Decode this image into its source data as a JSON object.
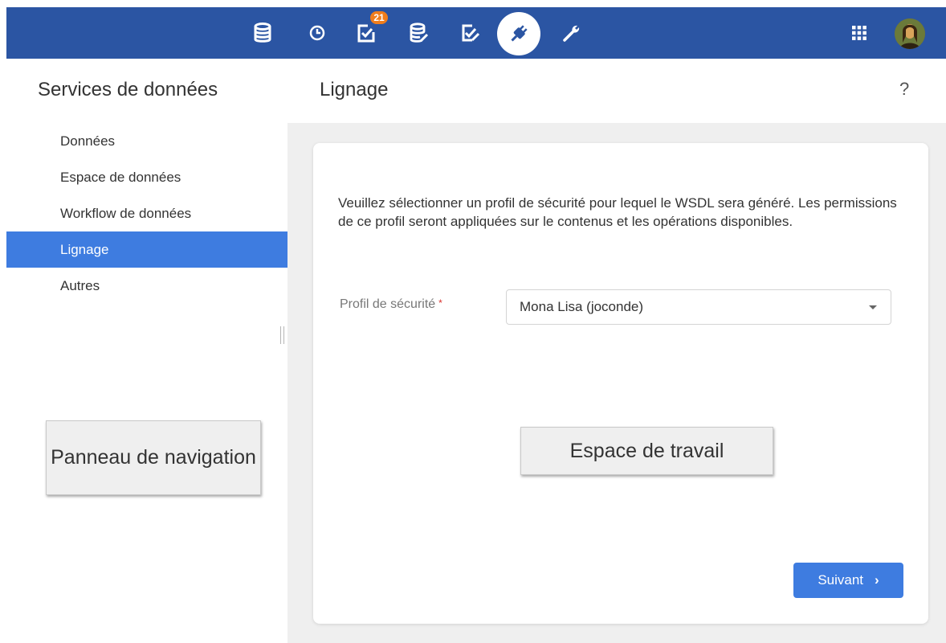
{
  "topbar": {
    "icons": [
      "database-icon",
      "clock-icon",
      "tasks-icon",
      "database-edit-icon",
      "checklist-icon",
      "plug-icon",
      "wrench-icon",
      "apps-grid-icon"
    ],
    "active_icon": "plug-icon",
    "tasks_badge": "21",
    "colors": {
      "bar": "#2b55a3",
      "badge": "#f07d1c"
    }
  },
  "header": {
    "section_title": "Services de données",
    "page_title": "Lignage",
    "help": "?"
  },
  "nav": {
    "items": [
      {
        "label": "Données"
      },
      {
        "label": "Espace de données"
      },
      {
        "label": "Workflow de données"
      },
      {
        "label": "Lignage",
        "active": true
      },
      {
        "label": "Autres"
      }
    ],
    "active_color": "#3e7ce0"
  },
  "main": {
    "description": "Veuillez sélectionner un profil de sécurité pour lequel le WSDL sera généré. Les permissions de ce profil seront appliquées sur le contenus et les opérations disponibles.",
    "field_label": "Profil de sécurité",
    "required_mark": "*",
    "select_value": "Mona Lisa (joconde)",
    "next_button": "Suivant",
    "next_chevron": "›"
  },
  "callouts": {
    "nav_panel": "Panneau de navigation",
    "workspace": "Espace de travail"
  }
}
